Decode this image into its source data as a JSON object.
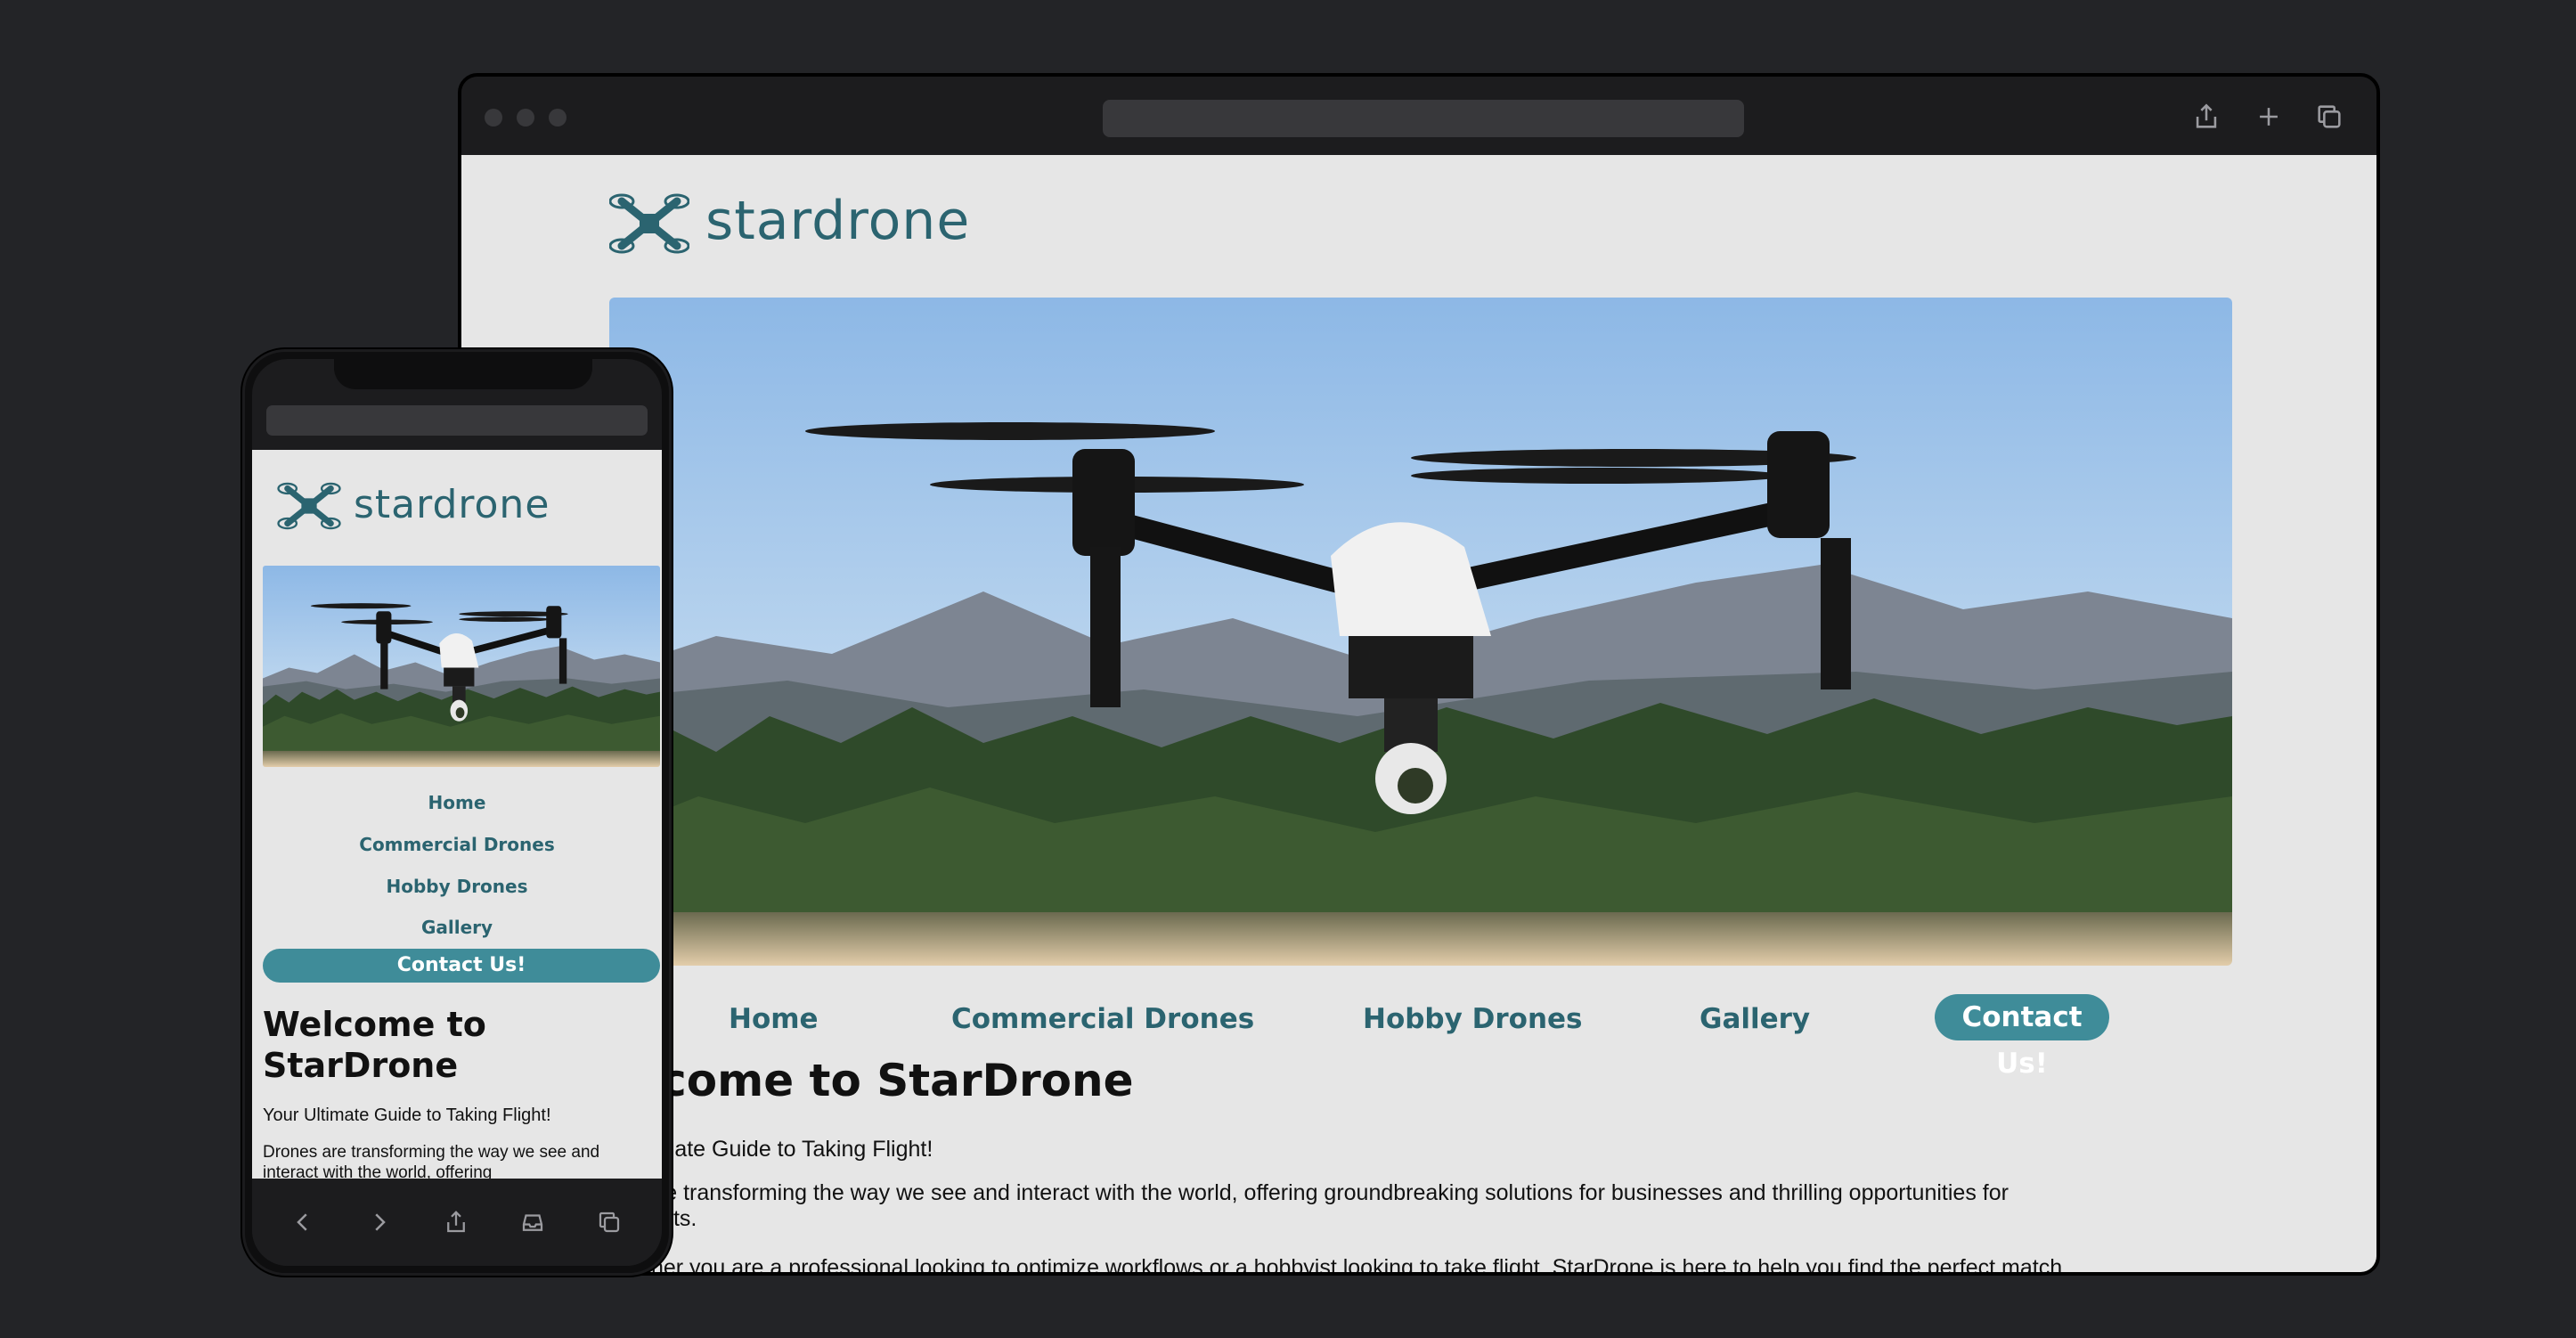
{
  "brand": {
    "name": "stardrone",
    "color": "#2b6470"
  },
  "nav": {
    "links": [
      "Home",
      "Commercial Drones",
      "Hobby Drones",
      "Gallery"
    ],
    "contact_label": "Contact Us!"
  },
  "desktop": {
    "heading": "lcome to StarDrone",
    "tagline": "timate Guide to Taking Flight!",
    "paragraph_line1": "are transforming the way we see and interact with the world, offering groundbreaking solutions for businesses and thrilling opportunities for",
    "paragraph_line2": "iasts.",
    "paragraph2_partial": "ther you are a professional looking to optimize workflows or a hobbyist looking to take flight, StarDrone is here to help you find the perfect match."
  },
  "mobile": {
    "heading": "Welcome to StarDrone",
    "tagline": "Your Ultimate Guide to Taking Flight!",
    "paragraph": "Drones are transforming the way we see and interact with the world, offering"
  },
  "colors": {
    "accent": "#3f8c99",
    "page_bg": "#e6e6e6",
    "backdrop": "#232427"
  },
  "icons": {
    "browser_toolbar": [
      "share-icon",
      "plus-icon",
      "tabs-icon"
    ],
    "phone_toolbar": [
      "back-icon",
      "forward-icon",
      "share-icon",
      "bookmarks-icon",
      "tabs-icon"
    ]
  }
}
